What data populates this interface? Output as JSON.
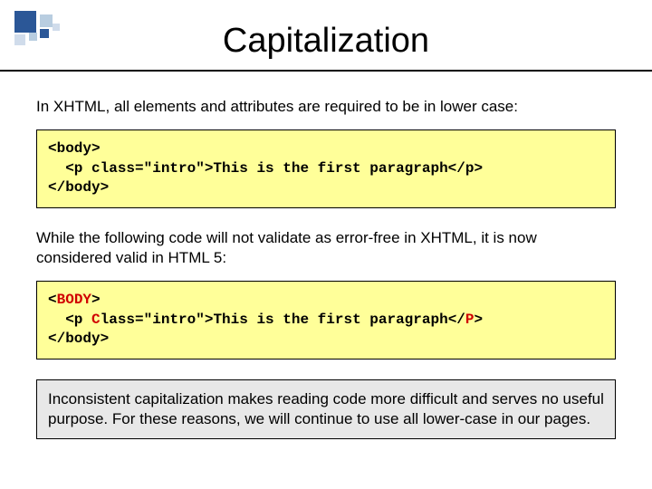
{
  "title": "Capitalization",
  "para1": "In XHTML, all elements and attributes are required to be in lower case:",
  "code1": {
    "l1a": "<body>",
    "l2a": "  <p class=\"intro\">This is the first paragraph</p>",
    "l3a": "</body>"
  },
  "para2": "While the following code will not validate as error-free in XHTML, it is now considered valid in HTML 5:",
  "code2": {
    "l1a": "<",
    "l1b": "BODY",
    "l1c": ">",
    "l2a": "  <p ",
    "l2b": "C",
    "l2c": "lass=\"intro\">This is the first paragraph</",
    "l2d": "P",
    "l2e": ">",
    "l3a": "</body>"
  },
  "note": "Inconsistent capitalization makes reading code more difficult and serves no useful purpose.  For these reasons, we will continue to use all lower-case in our pages."
}
